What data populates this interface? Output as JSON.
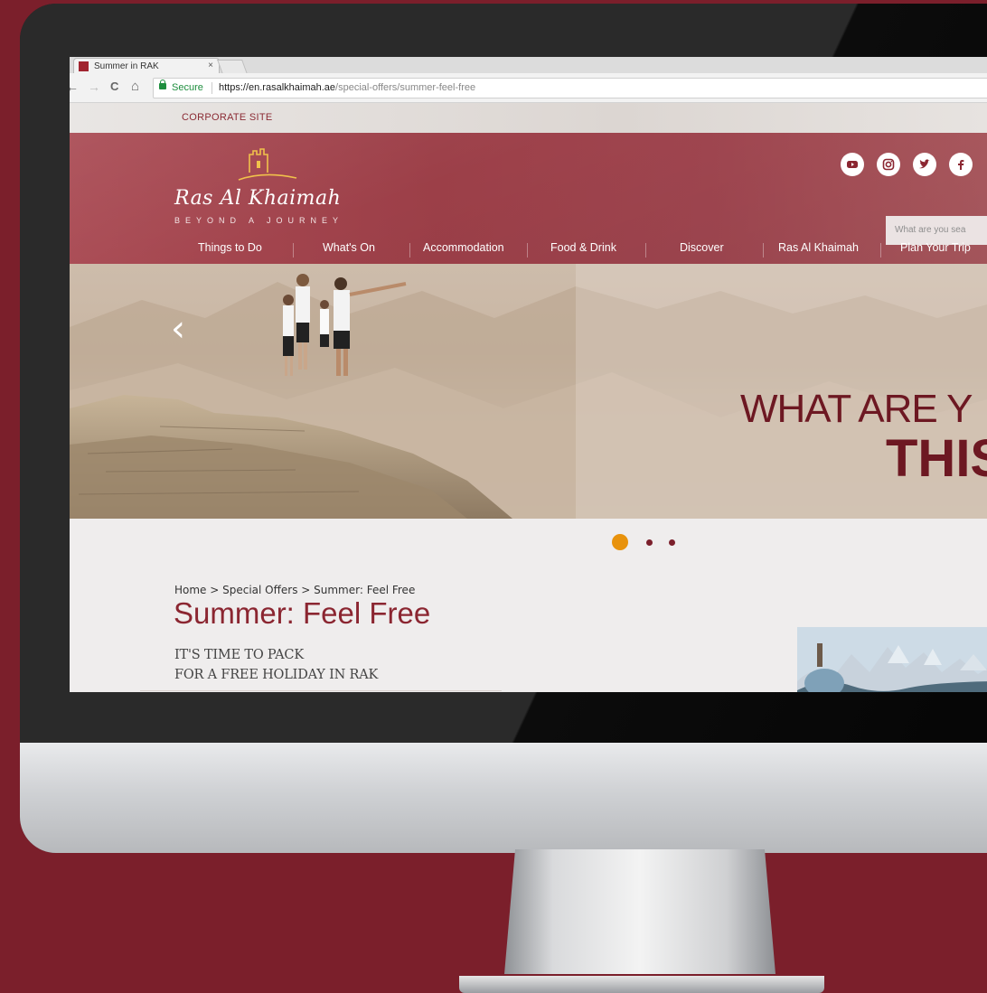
{
  "browser": {
    "tab_title": "Summer in RAK",
    "tab_close": "×",
    "secure_label": "Secure",
    "url_host": "https://en.rasalkhaimah.ae",
    "url_path": "/special-offers/summer-feel-free",
    "nav_back": "←",
    "nav_forward": "→",
    "nav_reload": "C",
    "nav_home": "⌂"
  },
  "site": {
    "corporate_link": "CORPORATE SITE",
    "logo_name": "Ras Al Khaimah",
    "logo_tagline": "BEYOND A JOURNEY",
    "search_placeholder": "What are you sea",
    "social_icons": [
      "youtube-icon",
      "instagram-icon",
      "twitter-icon",
      "facebook-icon"
    ],
    "nav": [
      "Things to Do",
      "What's On",
      "Accommodation",
      "Food & Drink",
      "Discover",
      "Ras Al Khaimah",
      "Plan Your Trip"
    ]
  },
  "hero": {
    "prev_arrow": "‹",
    "line1": "WHAT ARE Y",
    "line2": "THIS",
    "slide_count": 3,
    "active_slide": 1
  },
  "content": {
    "breadcrumb": "Home > Special Offers > Summer: Feel Free",
    "title": "Summer: Feel Free",
    "intro_line1": "IT'S TIME TO PACK",
    "intro_line2": "FOR A FREE HOLIDAY IN RAK"
  },
  "colors": {
    "brand": "#8b2631",
    "background": "#7b1f2b",
    "header": "#a04650",
    "active_dot": "#e8920c",
    "inactive_dot": "#7b1f2b"
  }
}
